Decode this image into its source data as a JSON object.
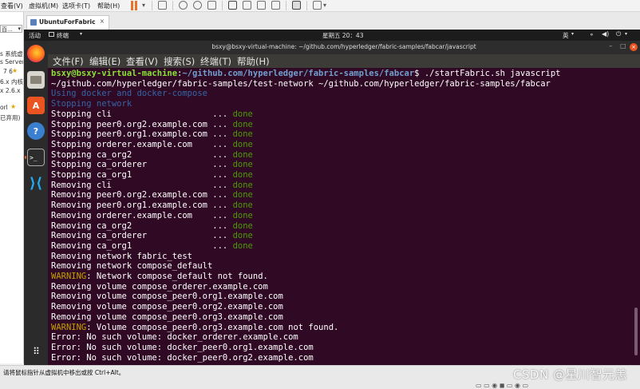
{
  "host": {
    "menus": [
      "查看(V)",
      "虚拟机(M)",
      "选项卡(T)",
      "帮助(H)"
    ],
    "left_lines": [
      "s 系统虚",
      "s Server",
      "7 6",
      "6.x 内核",
      "x 2.6.x",
      "orl",
      "已弃用)"
    ],
    "left_dropdown": "百..."
  },
  "vm_tab": {
    "title": "UbuntuForFabric",
    "close": "×"
  },
  "topbar": {
    "activities": "活动",
    "app": "终端",
    "clock": "星期五 20：43",
    "lang": "英"
  },
  "terminal": {
    "title": "bsxy@bsxy-virtual-machine: ~/github.com/hyperledger/fabric-samples/fabcar/javascript",
    "menu": [
      "文件(F)",
      "编辑(E)",
      "查看(V)",
      "搜索(S)",
      "终端(T)",
      "帮助(H)"
    ],
    "lines": [
      [
        {
          "t": "bsxy@bsxy-virtual-machine",
          "c": "user"
        },
        {
          "t": ":",
          "c": "white"
        },
        {
          "t": "~/github.com/hyperledger/fabric-samples/fabcar",
          "c": "path"
        },
        {
          "t": "$ ./startFabric.sh javascript",
          "c": "white"
        }
      ],
      [
        {
          "t": "~/github.com/hyperledger/fabric-samples/test-network ~/github.com/hyperledger/fabric-samples/fabcar",
          "c": "white"
        }
      ],
      [
        {
          "t": "Using docker and docker-compose",
          "c": "blue"
        }
      ],
      [
        {
          "t": "Stopping network",
          "c": "blue"
        }
      ],
      [
        {
          "t": "Stopping cli                    ... ",
          "c": "white"
        },
        {
          "t": "done",
          "c": "done"
        }
      ],
      [
        {
          "t": "Stopping peer0.org2.example.com ... ",
          "c": "white"
        },
        {
          "t": "done",
          "c": "done"
        }
      ],
      [
        {
          "t": "Stopping peer0.org1.example.com ... ",
          "c": "white"
        },
        {
          "t": "done",
          "c": "done"
        }
      ],
      [
        {
          "t": "Stopping orderer.example.com    ... ",
          "c": "white"
        },
        {
          "t": "done",
          "c": "done"
        }
      ],
      [
        {
          "t": "Stopping ca_org2                ... ",
          "c": "white"
        },
        {
          "t": "done",
          "c": "done"
        }
      ],
      [
        {
          "t": "Stopping ca_orderer             ... ",
          "c": "white"
        },
        {
          "t": "done",
          "c": "done"
        }
      ],
      [
        {
          "t": "Stopping ca_org1                ... ",
          "c": "white"
        },
        {
          "t": "done",
          "c": "done"
        }
      ],
      [
        {
          "t": "Removing cli                    ... ",
          "c": "white"
        },
        {
          "t": "done",
          "c": "done"
        }
      ],
      [
        {
          "t": "Removing peer0.org2.example.com ... ",
          "c": "white"
        },
        {
          "t": "done",
          "c": "done"
        }
      ],
      [
        {
          "t": "Removing peer0.org1.example.com ... ",
          "c": "white"
        },
        {
          "t": "done",
          "c": "done"
        }
      ],
      [
        {
          "t": "Removing orderer.example.com    ... ",
          "c": "white"
        },
        {
          "t": "done",
          "c": "done"
        }
      ],
      [
        {
          "t": "Removing ca_org2                ... ",
          "c": "white"
        },
        {
          "t": "done",
          "c": "done"
        }
      ],
      [
        {
          "t": "Removing ca_orderer             ... ",
          "c": "white"
        },
        {
          "t": "done",
          "c": "done"
        }
      ],
      [
        {
          "t": "Removing ca_org1                ... ",
          "c": "white"
        },
        {
          "t": "done",
          "c": "done"
        }
      ],
      [
        {
          "t": "Removing network fabric_test",
          "c": "white"
        }
      ],
      [
        {
          "t": "Removing network compose_default",
          "c": "white"
        }
      ],
      [
        {
          "t": "WARNING",
          "c": "warn"
        },
        {
          "t": ": Network compose_default not found.",
          "c": "white"
        }
      ],
      [
        {
          "t": "Removing volume compose_orderer.example.com",
          "c": "white"
        }
      ],
      [
        {
          "t": "Removing volume compose_peer0.org1.example.com",
          "c": "white"
        }
      ],
      [
        {
          "t": "Removing volume compose_peer0.org2.example.com",
          "c": "white"
        }
      ],
      [
        {
          "t": "Removing volume compose_peer0.org3.example.com",
          "c": "white"
        }
      ],
      [
        {
          "t": "WARNING",
          "c": "warn"
        },
        {
          "t": ": Volume compose_peer0.org3.example.com not found.",
          "c": "white"
        }
      ],
      [
        {
          "t": "Error: No such volume: docker_orderer.example.com",
          "c": "white"
        }
      ],
      [
        {
          "t": "Error: No such volume: docker_peer0.org1.example.com",
          "c": "white"
        }
      ],
      [
        {
          "t": "Error: No such volume: docker_peer0.org2.example.com",
          "c": "white"
        }
      ]
    ]
  },
  "status": {
    "hint": "请将鼠标指针从虚拟机中移出或按 Ctrl+Alt。",
    "watermark": "CSDN @星川智元恙"
  },
  "colors": {
    "terminal_bg": "#300a24",
    "prompt_user": "#8ae234",
    "prompt_path": "#729fcf",
    "info_blue": "#3465a4",
    "done_green": "#4e9a06",
    "warning_yellow": "#c4a000",
    "ubuntu_orange": "#e95420"
  }
}
